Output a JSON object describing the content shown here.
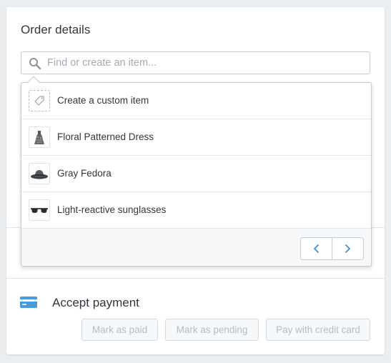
{
  "order": {
    "title": "Order details",
    "search": {
      "placeholder": "Find or create an item...",
      "value": ""
    }
  },
  "dropdown": {
    "items": [
      {
        "label": "Create a custom item",
        "icon": "tag-icon"
      },
      {
        "label": "Floral Patterned Dress",
        "icon": "dress-thumbnail"
      },
      {
        "label": "Gray Fedora",
        "icon": "fedora-thumbnail"
      },
      {
        "label": "Light-reactive sunglasses",
        "icon": "sunglasses-thumbnail"
      }
    ],
    "pagination": {
      "prev_icon": "chevron-left-icon",
      "next_icon": "chevron-right-icon"
    }
  },
  "payment": {
    "title": "Accept payment",
    "icon": "credit-card-icon",
    "buttons": {
      "mark_paid": "Mark as paid",
      "mark_pending": "Mark as pending",
      "pay_card": "Pay with credit card"
    }
  },
  "colors": {
    "accent": "#3b8ed6",
    "card_icon": "#4a99d8",
    "text": "#31373d",
    "placeholder": "#a4adb5",
    "disabled_text": "#b3bcc5",
    "background": "#ebeef0"
  }
}
